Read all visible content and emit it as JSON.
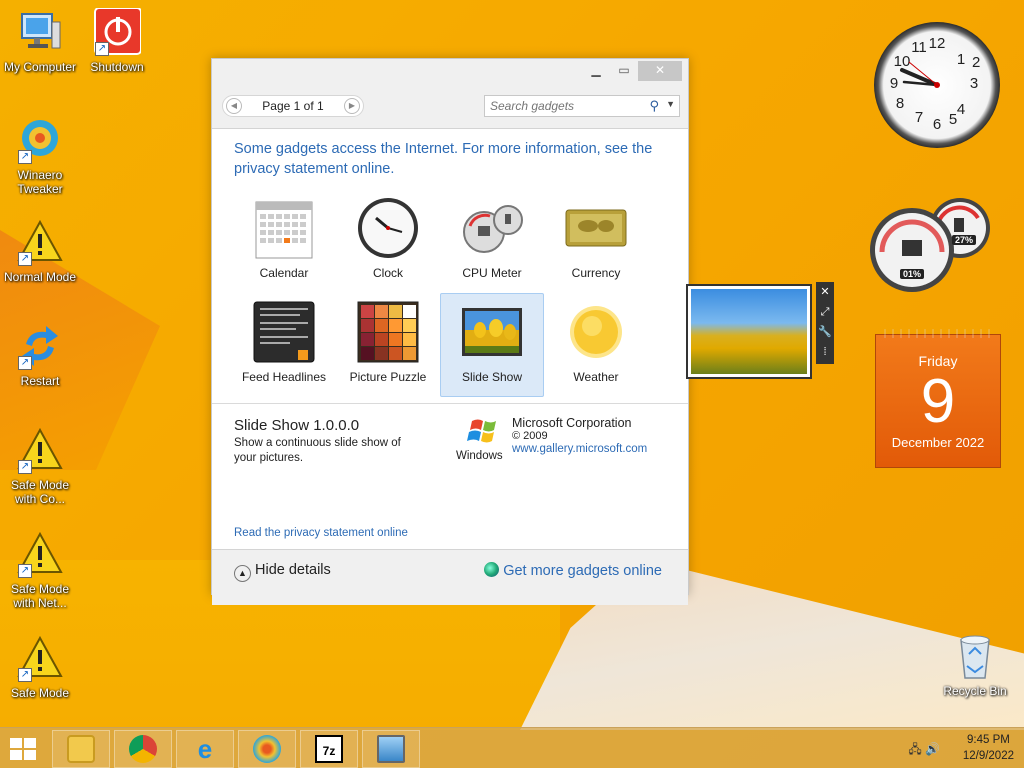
{
  "desktop": {
    "icons": [
      {
        "label": "My Computer",
        "icon": "computer-icon"
      },
      {
        "label": "Shutdown",
        "icon": "power-icon"
      },
      {
        "label": "Winaero Tweaker",
        "icon": "winaero-icon"
      },
      {
        "label": "Normal Mode",
        "icon": "warning-icon"
      },
      {
        "label": "Restart",
        "icon": "restart-icon"
      },
      {
        "label": "Safe Mode with Co...",
        "icon": "warning-icon"
      },
      {
        "label": "Safe Mode with Net...",
        "icon": "warning-icon"
      },
      {
        "label": "Safe Mode",
        "icon": "warning-icon"
      },
      {
        "label": "Recycle Bin",
        "icon": "recycle-bin-icon"
      }
    ]
  },
  "gadget_window": {
    "pager_text": "Page 1 of 1",
    "search_placeholder": "Search gadgets",
    "notice": "Some gadgets access the Internet.  For more information, see the privacy statement online.",
    "gadgets": [
      {
        "label": "Calendar",
        "icon": "calendar-gadget-icon"
      },
      {
        "label": "Clock",
        "icon": "clock-gadget-icon"
      },
      {
        "label": "CPU Meter",
        "icon": "cpu-meter-gadget-icon"
      },
      {
        "label": "Currency",
        "icon": "currency-gadget-icon"
      },
      {
        "label": "Feed Headlines",
        "icon": "feed-headlines-gadget-icon"
      },
      {
        "label": "Picture Puzzle",
        "icon": "picture-puzzle-gadget-icon"
      },
      {
        "label": "Slide Show",
        "icon": "slide-show-gadget-icon",
        "selected": true
      },
      {
        "label": "Weather",
        "icon": "weather-gadget-icon"
      }
    ],
    "details": {
      "name": "Slide Show 1.0.0.0",
      "description": "Show a continuous slide show of your pictures.",
      "publisher": "Microsoft Corporation",
      "copyright": "© 2009",
      "url": "www.gallery.microsoft.com",
      "logo_text": "Windows"
    },
    "privacy_link": "Read the privacy statement online",
    "hide_details": "Hide details",
    "get_more": "Get more gadgets online"
  },
  "desktop_gadgets": {
    "calendar": {
      "day": "Friday",
      "date": "9",
      "month": "December 2022"
    },
    "cpu_meter": {
      "cpu": "01%",
      "memory": "27%"
    }
  },
  "taskbar": {
    "time": "9:45 PM",
    "date": "12/9/2022",
    "apps": [
      "file-explorer-icon",
      "chrome-icon",
      "internet-explorer-icon",
      "winaero-icon",
      "7zip-icon",
      "remote-desktop-icon"
    ],
    "seven_zip_label": "7z"
  },
  "colors": {
    "accent_blue": "#2d6bb5",
    "desktop_orange": "#f5b000",
    "calendar_orange": "#e8670e"
  }
}
